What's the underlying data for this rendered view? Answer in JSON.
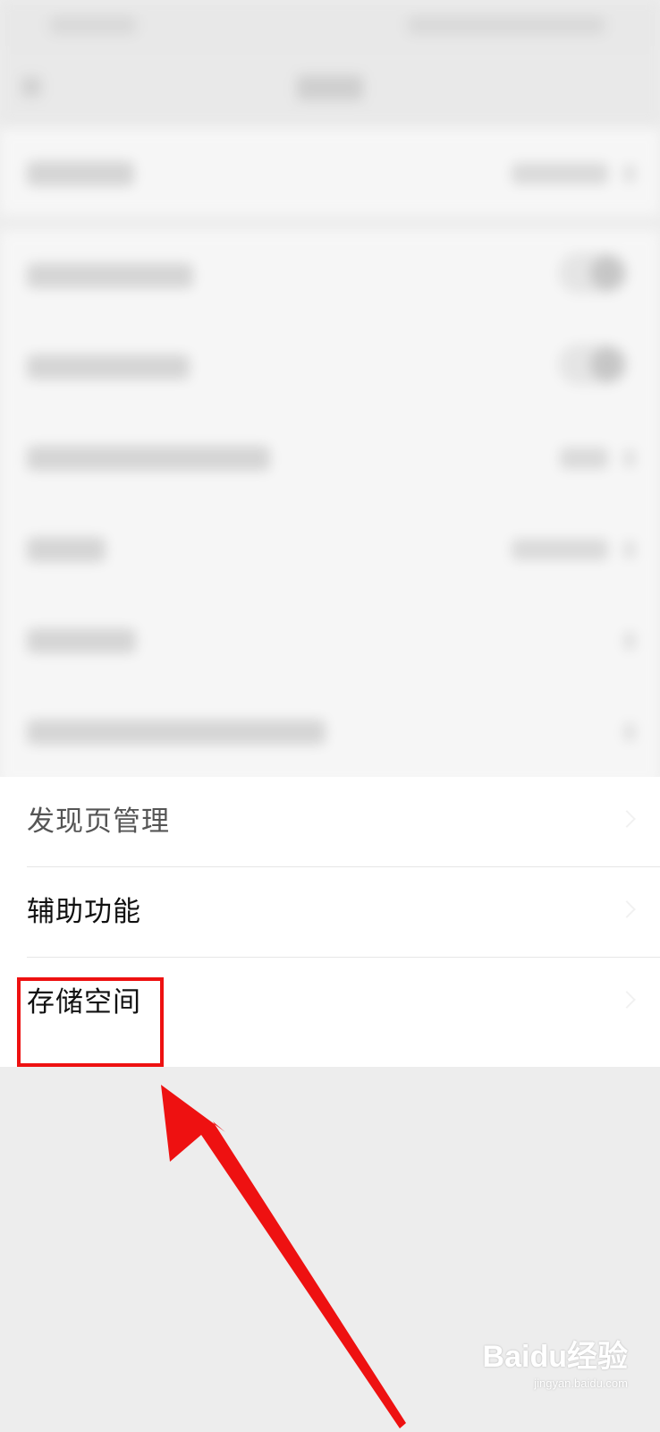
{
  "settings_list": {
    "items": [
      {
        "label": "发现页管理"
      },
      {
        "label": "辅助功能"
      },
      {
        "label": "存储空间"
      }
    ]
  },
  "annotation": {
    "highlight_color": "#ee1111"
  },
  "watermark": {
    "brand": "Baidu经验",
    "url": "jingyan.baidu.com"
  }
}
